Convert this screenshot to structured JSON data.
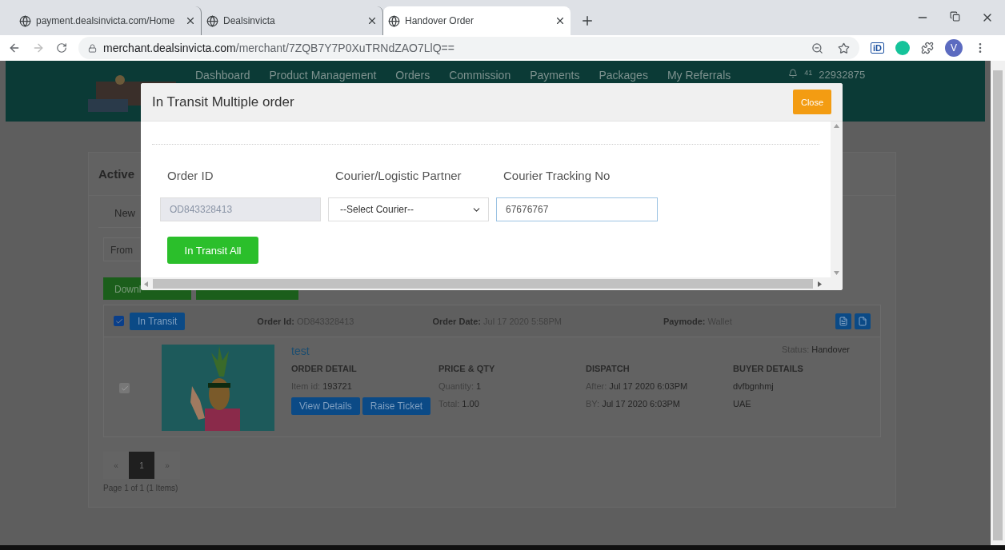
{
  "browser": {
    "tabs": [
      {
        "title": "payment.dealsinvicta.com/Home",
        "selected": false
      },
      {
        "title": "Dealsinvicta",
        "selected": false
      },
      {
        "title": "Handover Order",
        "selected": true
      }
    ],
    "url": {
      "host": "merchant.dealsinvicta.com",
      "path": "/merchant/7ZQB7Y7P0XuTRNdZAO7LlQ=="
    },
    "extension_label": "iD",
    "profile_initial": "V"
  },
  "header": {
    "nav": [
      "Dashboard",
      "Product Management",
      "Orders",
      "Commission",
      "Payments",
      "Packages",
      "My Referrals"
    ],
    "notification_count": "41",
    "account": "22932875"
  },
  "panel": {
    "title": "Active",
    "tab": "New",
    "filter_placeholder": "From",
    "download_button": "Downl"
  },
  "order": {
    "selected": true,
    "status_button": "In Transit",
    "meta": [
      {
        "label": "Order Id:",
        "value": "OD843328413"
      },
      {
        "label": "Order Date:",
        "value": "Jul 17 2020 5:58PM"
      },
      {
        "label": "Paymode:",
        "value": "Wallet"
      }
    ],
    "row_checked": true,
    "product": "test",
    "status": {
      "label": "Status:",
      "value": "Handover"
    },
    "columns": [
      {
        "heading": "ORDER DETAIL",
        "lines": [
          {
            "label": "Item id:",
            "value": "193721"
          }
        ]
      },
      {
        "heading": "PRICE & QTY",
        "lines": [
          {
            "label": "Quantity:",
            "value": "1"
          },
          {
            "label": "Total:",
            "value": "1.00"
          }
        ]
      },
      {
        "heading": "DISPATCH",
        "lines": [
          {
            "label": "After:",
            "value": "Jul 17 2020 6:03PM"
          },
          {
            "label": "BY:",
            "value": "Jul 17 2020 6:03PM"
          }
        ]
      },
      {
        "heading": "BUYER DETAILS",
        "lines": [
          {
            "value": "dvfbgnhmj"
          },
          {
            "value": "UAE"
          }
        ]
      }
    ],
    "actions": [
      "View Details",
      "Raise Ticket"
    ]
  },
  "pagination": {
    "prev": "«",
    "pages": [
      {
        "label": "1",
        "selected": true
      }
    ],
    "next": "»",
    "summary": "Page 1 of 1 (1 Items)"
  },
  "modal": {
    "title": "In Transit Multiple order",
    "close": "Close",
    "fields": [
      {
        "label": "Order ID",
        "kind": "readonly",
        "value": "OD843328413"
      },
      {
        "label": "Courier/Logistic Partner",
        "kind": "select",
        "value": "--Select Courier--"
      },
      {
        "label": "Courier Tracking No",
        "kind": "text",
        "value": "67676767",
        "focused": true
      }
    ],
    "submit": "In Transit All"
  }
}
